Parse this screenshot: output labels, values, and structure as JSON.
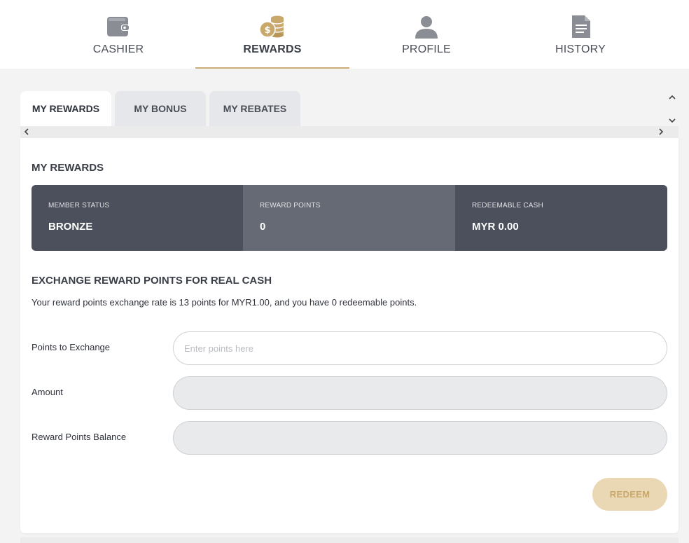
{
  "nav": {
    "items": [
      {
        "label": "CASHIER",
        "icon": "wallet-icon"
      },
      {
        "label": "REWARDS",
        "icon": "coins-icon",
        "active": true
      },
      {
        "label": "PROFILE",
        "icon": "user-icon"
      },
      {
        "label": "HISTORY",
        "icon": "document-icon"
      }
    ]
  },
  "tabs": [
    {
      "label": "MY REWARDS",
      "active": true
    },
    {
      "label": "MY BONUS"
    },
    {
      "label": "MY REBATES"
    }
  ],
  "rewards": {
    "title": "MY REWARDS",
    "stats": [
      {
        "label": "MEMBER STATUS",
        "value": "BRONZE"
      },
      {
        "label": "REWARD POINTS",
        "value": "0"
      },
      {
        "label": "REDEEMABLE CASH",
        "value": "MYR 0.00"
      }
    ]
  },
  "exchange": {
    "title": "EXCHANGE REWARD POINTS FOR REAL CASH",
    "info": "Your reward points exchange rate is 13 points for MYR1.00, and you have 0 redeemable points.",
    "points_label": "Points to Exchange",
    "points_placeholder": "Enter points here",
    "amount_label": "Amount",
    "balance_label": "Reward Points Balance",
    "redeem_label": "REDEEM"
  },
  "colors": {
    "accent": "#c9ac78",
    "stat_dark": "#4c505c",
    "stat_mid": "#666a75",
    "redeem_bg": "#ead8b5"
  }
}
